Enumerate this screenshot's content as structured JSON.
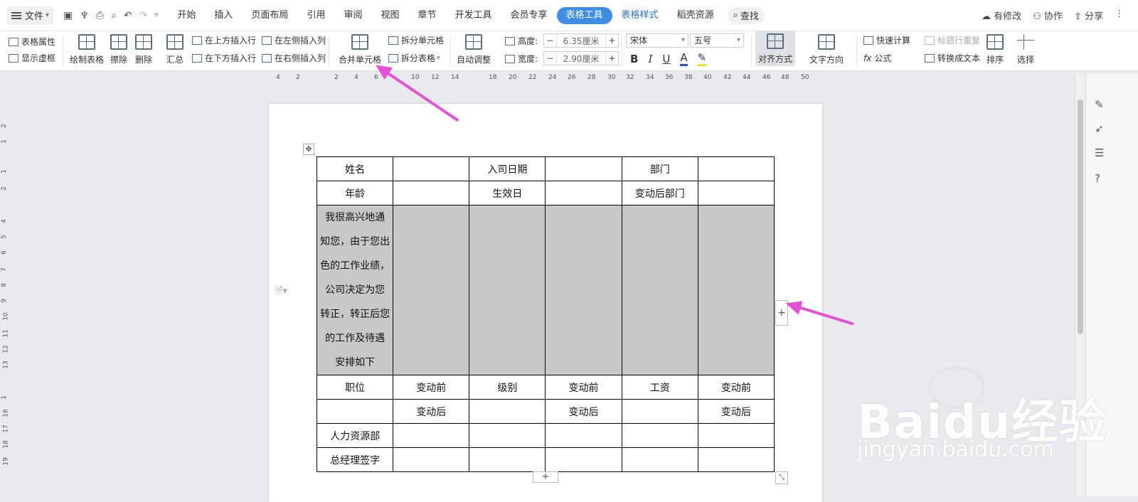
{
  "menu": {
    "file": "文件",
    "tabs": [
      "开始",
      "插入",
      "页面布局",
      "引用",
      "审阅",
      "视图",
      "章节",
      "开发工具",
      "会员专享",
      "表格工具",
      "表格样式",
      "稻壳资源"
    ],
    "active_tab": "表格工具",
    "search": "查找",
    "right": [
      "有修改",
      "协作",
      "分享"
    ]
  },
  "ribbon": {
    "table_props": "表格属性",
    "show_gridlines": "显示虚框",
    "draw_table": "绘制表格",
    "erase": "擦除",
    "delete": "删除",
    "summary": "汇总",
    "insert_above": "在上方插入行",
    "insert_below": "在下方插入行",
    "insert_left": "在左侧插入列",
    "insert_right": "在右侧插入列",
    "merge_cells": "合并单元格",
    "split_cells": "拆分单元格",
    "split_table": "拆分表格",
    "auto_fit": "自动调整",
    "height_label": "高度:",
    "height_value": "6.35厘米",
    "width_label": "宽度:",
    "width_value": "2.90厘米",
    "font": "宋体",
    "font_size": "五号",
    "align": "对齐方式",
    "text_direction": "文字方向",
    "quick_calc": "快速计算",
    "title_repeat": "标题行重复",
    "formula": "公式",
    "to_text": "转换成文本",
    "sort": "排序",
    "select": "选择"
  },
  "ruler_h": [
    "4",
    "2",
    "2",
    "4",
    "6",
    "10",
    "12",
    "14",
    "18",
    "20",
    "22",
    "24",
    "26",
    "28",
    "30",
    "32",
    "34",
    "36",
    "38",
    "40",
    "42",
    "44",
    "46",
    "48",
    "50"
  ],
  "ruler_v": [
    "2",
    "1",
    "1",
    "2",
    "4",
    "5",
    "6",
    "7",
    "8",
    "9",
    "10",
    "11",
    "12",
    "13",
    "1",
    "16",
    "17",
    "18",
    "19"
  ],
  "table": {
    "r1": [
      "姓名",
      "",
      "入司日期",
      "",
      "部门",
      ""
    ],
    "r2": [
      "年龄",
      "",
      "生效日",
      "",
      "变动后部门",
      ""
    ],
    "note_lines": [
      "我很高兴地通",
      "知您，由于您出",
      "色的工作业绩，",
      "公司决定为您",
      "转正，转正后您",
      "的工作及待遇",
      "安排如下"
    ],
    "r4": [
      "职位",
      "变动前",
      "级别",
      "变动前",
      "工资",
      "变动前"
    ],
    "r5": [
      "",
      "变动后",
      "",
      "变动后",
      "",
      "变动后"
    ],
    "r6": [
      "人力资源部",
      "",
      "",
      "",
      "",
      ""
    ],
    "r7": [
      "总经理签字",
      "",
      "",
      "",
      "",
      ""
    ]
  },
  "watermark": {
    "brand": "Baidu经验",
    "url": "jingyan.baidu.com"
  },
  "colors": {
    "accent": "#3e8ee8",
    "arrow": "#e64fd6",
    "gray_fill": "#c8c8c8"
  }
}
